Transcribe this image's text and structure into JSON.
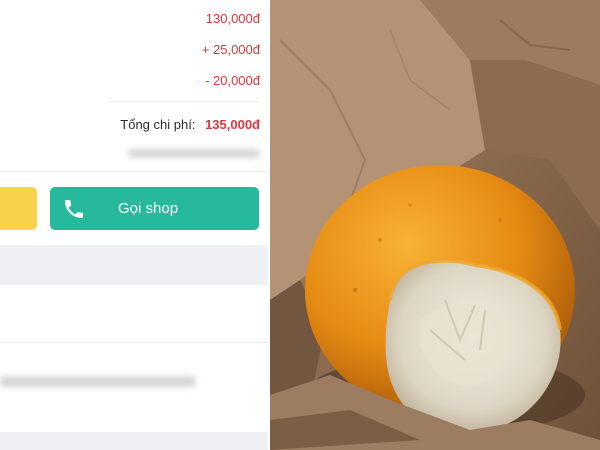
{
  "order_summary": {
    "subtotal": "130,000đ",
    "shipping_fee": "+ 25,000đ",
    "discount": "- 20,000đ",
    "total_label": "Tổng chi phí:",
    "total_value": "135,000đ"
  },
  "actions": {
    "call_shop_label": "Gọi shop",
    "call_icon": "phone-icon"
  },
  "colors": {
    "price_red": "#d9383c",
    "call_button_green": "#27b99c",
    "yellow_button": "#f7d24a"
  },
  "photo": {
    "subject": "peeled-orange-in-box"
  }
}
